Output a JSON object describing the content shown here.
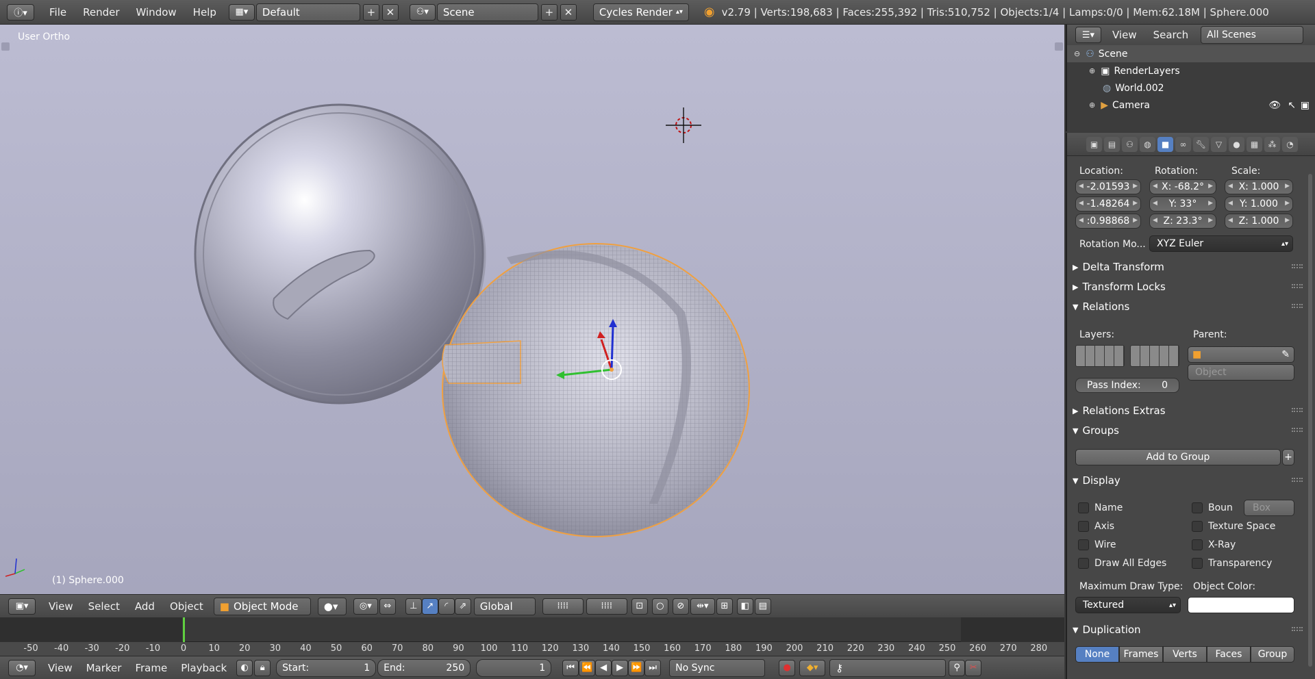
{
  "app": {
    "menus": [
      "File",
      "Render",
      "Window",
      "Help"
    ],
    "layout": "Default",
    "scene": "Scene",
    "engine": "Cycles Render",
    "stats": "v2.79 | Verts:198,683 | Faces:255,392 | Tris:510,752 | Objects:1/4 | Lamps:0/0 | Mem:62.18M | Sphere.000"
  },
  "viewport": {
    "view_label": "User Ortho",
    "object_label": "(1) Sphere.000",
    "bg_top": "#bcbcd2",
    "bg_bottom": "#a6a6bd",
    "header": {
      "menus": [
        "View",
        "Select",
        "Add",
        "Object"
      ],
      "mode": "Object Mode",
      "orientation": "Global"
    }
  },
  "timeline": {
    "ticks": [
      "-50",
      "-40",
      "-30",
      "-20",
      "-10",
      "0",
      "10",
      "20",
      "30",
      "40",
      "50",
      "60",
      "70",
      "80",
      "90",
      "100",
      "110",
      "120",
      "130",
      "140",
      "150",
      "160",
      "170",
      "180",
      "190",
      "200",
      "210",
      "220",
      "230",
      "240",
      "250",
      "260",
      "270",
      "280"
    ],
    "current_frame_marker": "0",
    "header": {
      "menus": [
        "View",
        "Marker",
        "Frame",
        "Playback"
      ],
      "start_label": "Start:",
      "start": "1",
      "end_label": "End:",
      "end": "250",
      "current": "1",
      "sync": "No Sync"
    }
  },
  "outliner": {
    "menus": [
      "View",
      "Search"
    ],
    "filter": "All Scenes",
    "items": [
      "Scene",
      "RenderLayers",
      "World.002",
      "Camera"
    ]
  },
  "properties": {
    "location_label": "Location:",
    "rotation_label": "Rotation:",
    "scale_label": "Scale:",
    "location": [
      "-2.01593",
      "-1.48264",
      ":0.98868"
    ],
    "rotation": [
      "X:  -68.2°",
      "Y:      33°",
      "Z:    23.3°"
    ],
    "scale": [
      "X:   1.000",
      "Y:   1.000",
      "Z:   1.000"
    ],
    "rotation_mode_label": "Rotation Mo...",
    "rotation_mode": "XYZ Euler",
    "delta_transform": "Delta Transform",
    "transform_locks": "Transform Locks",
    "relations": "Relations",
    "layers_label": "Layers:",
    "parent_label": "Parent:",
    "parent_type": "Object",
    "pass_index_label": "Pass Index:",
    "pass_index": "0",
    "relations_extras": "Relations Extras",
    "groups": "Groups",
    "add_to_group": "Add to Group",
    "display": "Display",
    "display_opts": {
      "name": "Name",
      "bounds": "Boun",
      "bounds_type": "Box",
      "axis": "Axis",
      "texture_space": "Texture Space",
      "wire": "Wire",
      "xray": "X-Ray",
      "draw_all_edges": "Draw All Edges",
      "transparency": "Transparency"
    },
    "max_draw_type_label": "Maximum Draw Type:",
    "max_draw_type": "Textured",
    "object_color_label": "Object Color:",
    "duplication": "Duplication",
    "dup_options": [
      "None",
      "Frames",
      "Verts",
      "Faces",
      "Group"
    ],
    "accent": "#5680c2"
  }
}
